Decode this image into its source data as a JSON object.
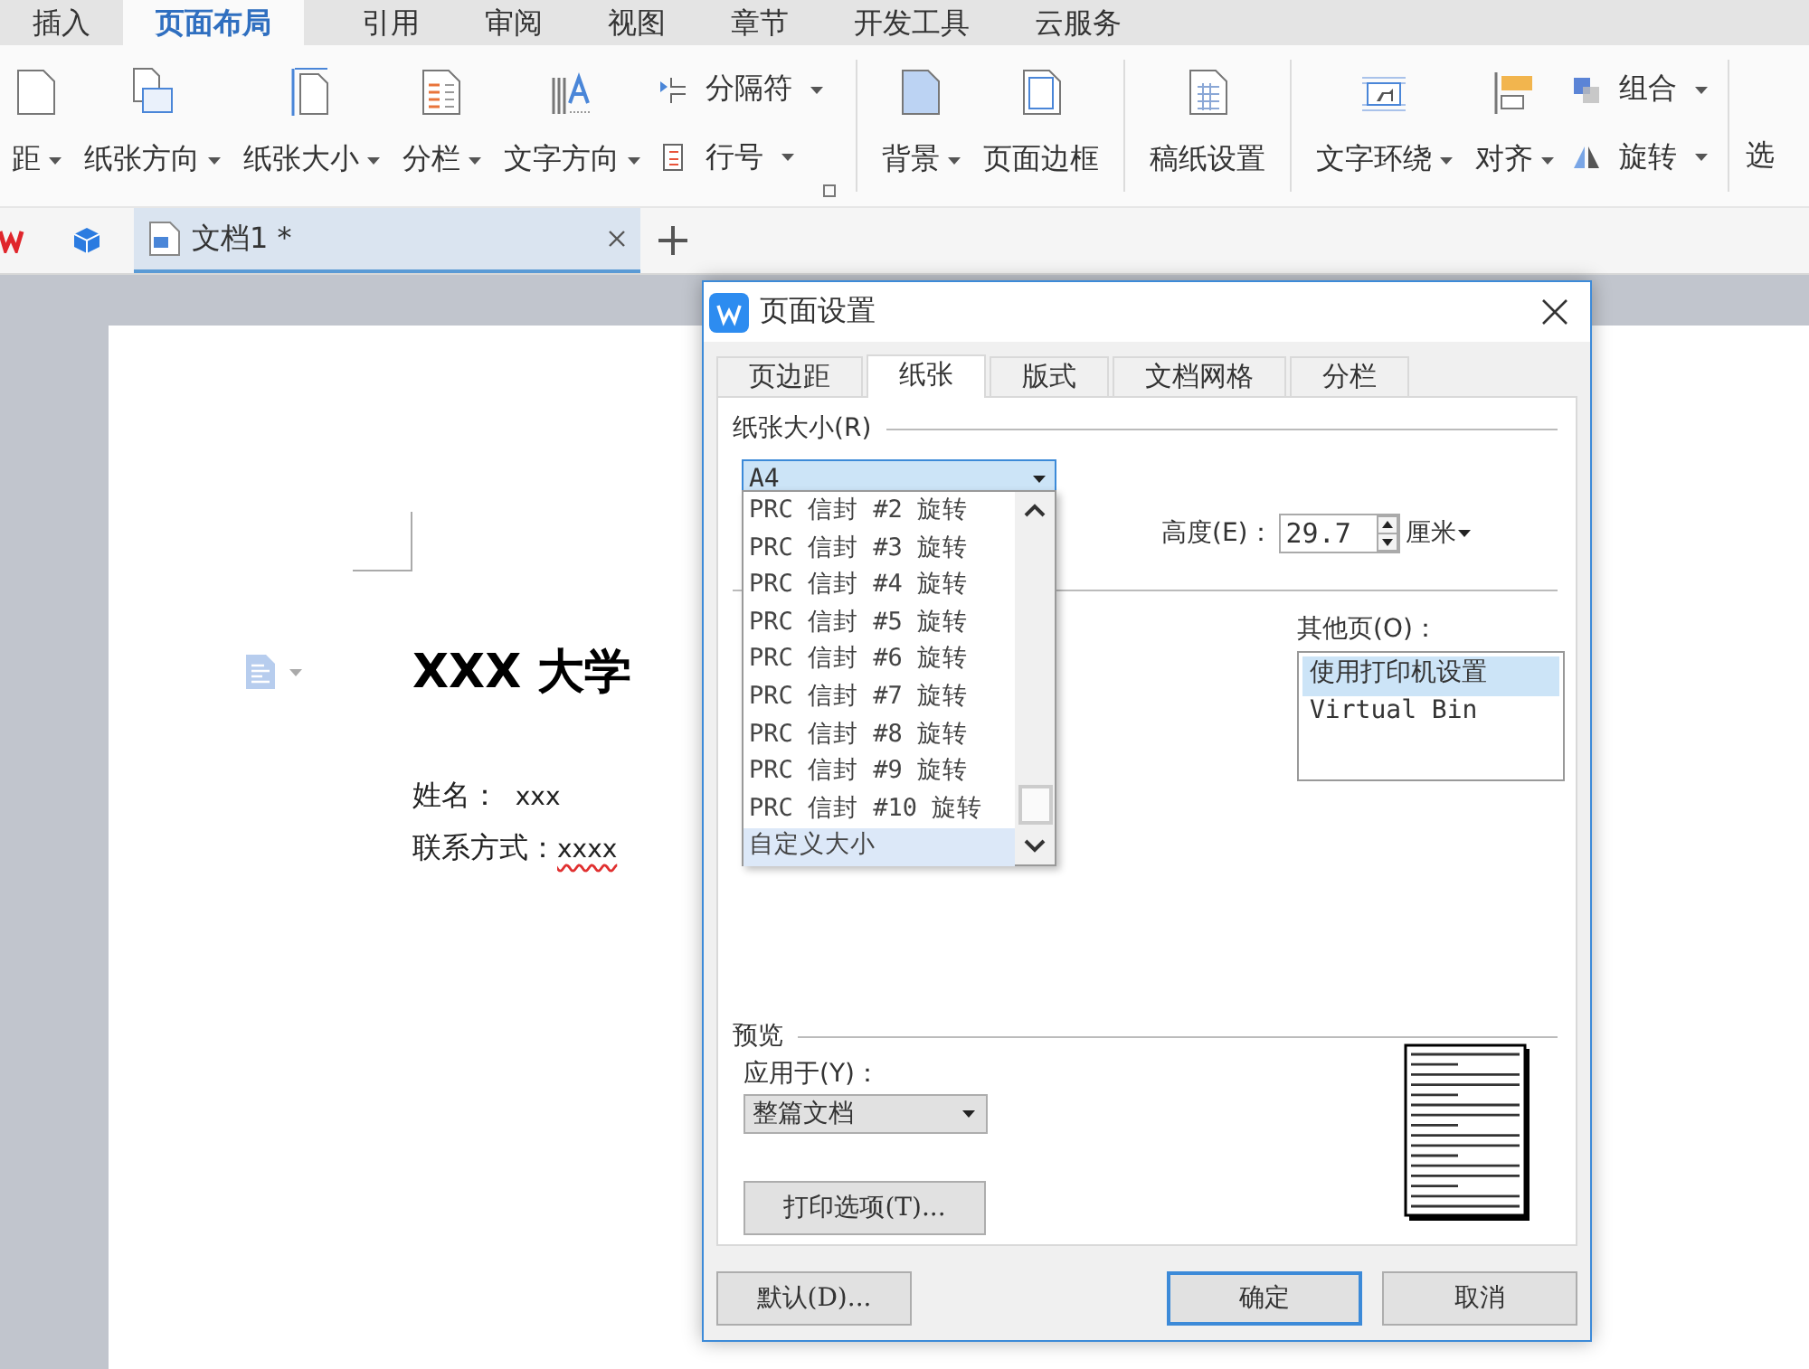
{
  "menu_tabs": [
    {
      "label": "插入",
      "selected": false
    },
    {
      "label": "页面布局",
      "selected": true
    },
    {
      "label": "引用",
      "selected": false
    },
    {
      "label": "审阅",
      "selected": false
    },
    {
      "label": "视图",
      "selected": false
    },
    {
      "label": "章节",
      "selected": false
    },
    {
      "label": "开发工具",
      "selected": false
    },
    {
      "label": "云服务",
      "selected": false
    }
  ],
  "ribbon": [
    {
      "kind": "large",
      "label": "距",
      "dropdown": true
    },
    {
      "kind": "large",
      "label": "纸张方向",
      "dropdown": true
    },
    {
      "kind": "large",
      "label": "纸张大小",
      "dropdown": true
    },
    {
      "kind": "large",
      "label": "分栏",
      "dropdown": true
    },
    {
      "kind": "large",
      "label": "文字方向",
      "dropdown": true
    },
    {
      "kind": "stack",
      "items": [
        {
          "label": "分隔符",
          "dropdown": true
        },
        {
          "label": "行号",
          "dropdown": true
        }
      ]
    },
    {
      "kind": "launcher"
    },
    {
      "kind": "separator"
    },
    {
      "kind": "large",
      "label": "背景",
      "dropdown": true
    },
    {
      "kind": "large",
      "label": "页面边框",
      "dropdown": false
    },
    {
      "kind": "separator"
    },
    {
      "kind": "large",
      "label": "稿纸设置",
      "dropdown": false
    },
    {
      "kind": "separator"
    },
    {
      "kind": "large",
      "label": "文字环绕",
      "dropdown": true
    },
    {
      "kind": "large",
      "label": "对齐",
      "dropdown": true
    },
    {
      "kind": "stack",
      "items": [
        {
          "label": "组合",
          "dropdown": true
        },
        {
          "label": "旋转",
          "dropdown": true
        }
      ]
    },
    {
      "kind": "separator"
    },
    {
      "kind": "cut",
      "label": "选"
    }
  ],
  "doc_tabs": [
    {
      "label": "文档1 *",
      "selected": true
    }
  ],
  "document": {
    "title": "XXX 大学",
    "lines": [
      {
        "label": "姓名：",
        "value": "  xxx",
        "spell_error": false
      },
      {
        "label": "联系方式：",
        "value": "xxxx",
        "spell_error": true
      }
    ]
  },
  "dialog": {
    "title": "页面设置",
    "tabs": [
      {
        "label": "页边距",
        "selected": false
      },
      {
        "label": "纸张",
        "selected": true
      },
      {
        "label": "版式",
        "selected": false
      },
      {
        "label": "文档网格",
        "selected": false
      },
      {
        "label": "分栏",
        "selected": false
      }
    ],
    "paper_size": {
      "label": "纸张大小(R)",
      "value": "A4",
      "open": true,
      "list": [
        {
          "label": "PRC 信封 #2 旋转",
          "selected": false
        },
        {
          "label": "PRC 信封 #3 旋转",
          "selected": false
        },
        {
          "label": "PRC 信封 #4 旋转",
          "selected": false
        },
        {
          "label": "PRC 信封 #5 旋转",
          "selected": false
        },
        {
          "label": "PRC 信封 #6 旋转",
          "selected": false
        },
        {
          "label": "PRC 信封 #7 旋转",
          "selected": false
        },
        {
          "label": "PRC 信封 #8 旋转",
          "selected": false
        },
        {
          "label": "PRC 信封 #9 旋转",
          "selected": false
        },
        {
          "label": "PRC 信封 #10 旋转",
          "selected": false
        },
        {
          "label": "自定义大小",
          "selected": true
        }
      ]
    },
    "height": {
      "label": "高度(E)：",
      "value": "29.7",
      "unit": "厘米"
    },
    "other_pages": {
      "label": "其他页(O)：",
      "items": [
        {
          "label": "使用打印机设置",
          "selected": true
        },
        {
          "label": "Virtual Bin",
          "selected": false
        }
      ]
    },
    "preview": {
      "label": "预览",
      "apply_to_label": "应用于(Y)：",
      "apply_to": "整篇文档",
      "print_options": "打印选项(T)..."
    },
    "buttons": [
      {
        "label": "默认(D)...",
        "default": false
      },
      {
        "label": "确定",
        "default": true
      },
      {
        "label": "取消",
        "default": false
      }
    ]
  }
}
